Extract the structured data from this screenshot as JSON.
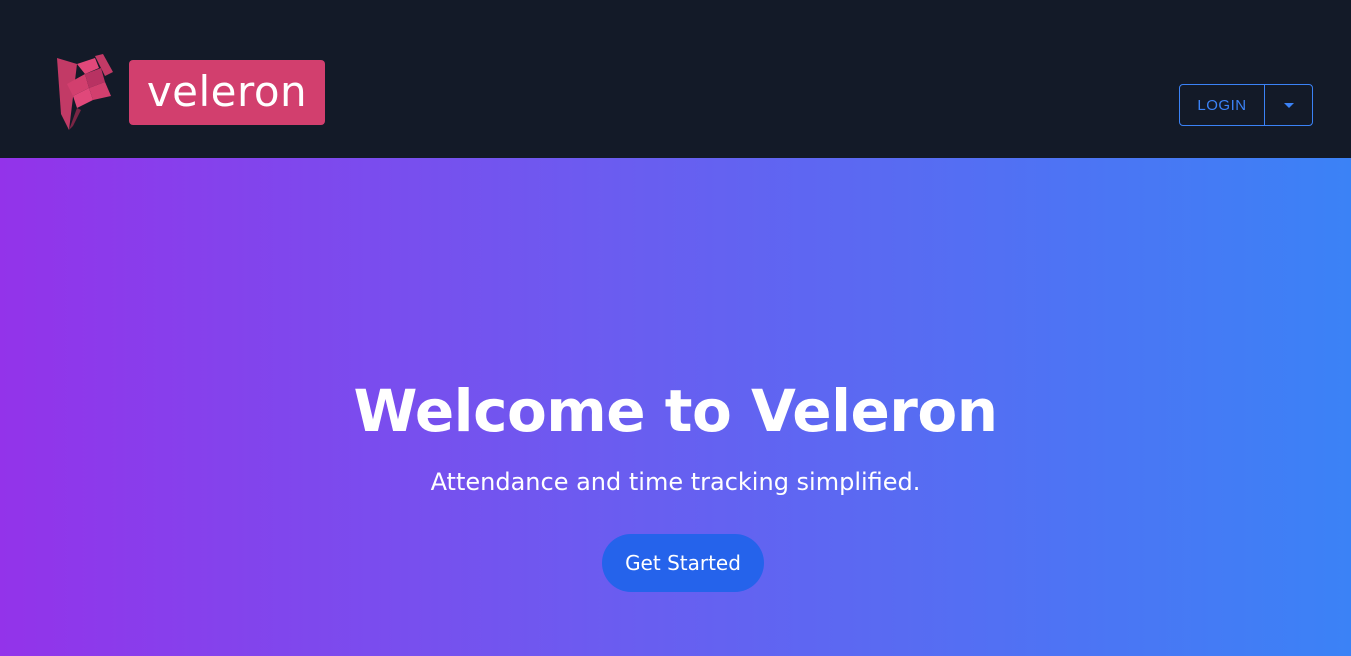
{
  "header": {
    "logo": {
      "icon": "veleron-flag-logo",
      "text": "veleron",
      "badge_color": "#d23f6e",
      "mark_color": "#d23f6e"
    },
    "login": {
      "label": "LOGIN",
      "dropdown_icon": "caret-down-icon",
      "color": "#3b82f6"
    },
    "background": "#131a28"
  },
  "hero": {
    "title": "Welcome to Veleron",
    "subtitle": "Attendance and time tracking simplified.",
    "cta_label": "Get Started",
    "cta_color": "#2563eb",
    "gradient_start": "#9333ea",
    "gradient_end": "#3b82f6"
  }
}
